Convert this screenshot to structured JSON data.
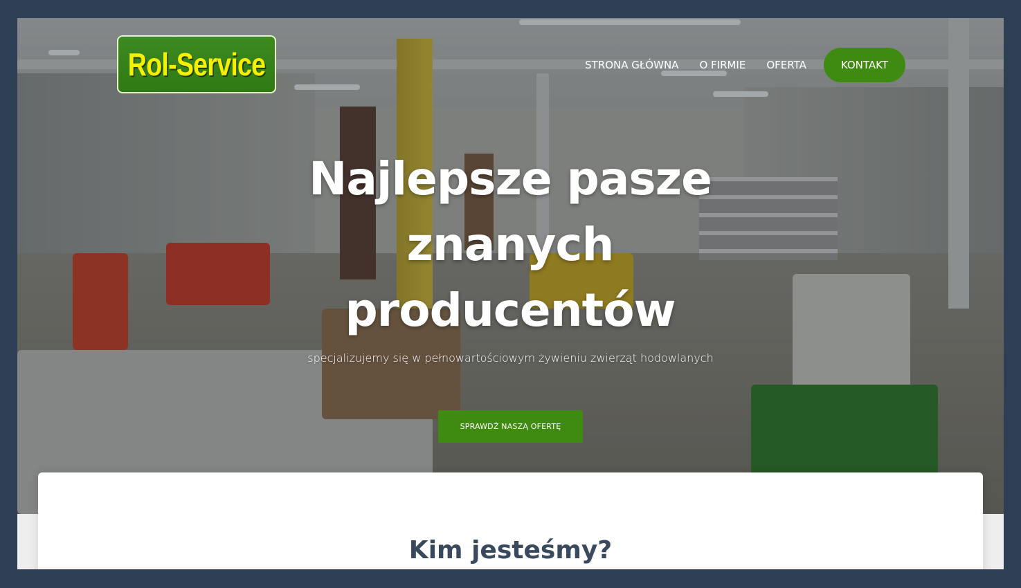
{
  "logo": {
    "text": "Rol-Service"
  },
  "nav": {
    "items": [
      {
        "label": "STRONA GŁÓWNA"
      },
      {
        "label": "O FIRMIE"
      },
      {
        "label": "OFERTA"
      }
    ],
    "cta_label": "KONTAKT"
  },
  "hero": {
    "title": "Najlepsze pasze znanych producentów",
    "subtitle": "specjalizujemy się w pełnowartościowym żywieniu zwierząt hodowlanych",
    "button_label": "SPRAWDŹ NASZĄ OFERTĘ"
  },
  "about": {
    "title": "Kim jesteśmy?"
  },
  "colors": {
    "accent_green": "#3f8a10",
    "page_border": "#2e3f55",
    "heading_dark": "#3a4a5e",
    "logo_yellow": "#f4f000"
  }
}
